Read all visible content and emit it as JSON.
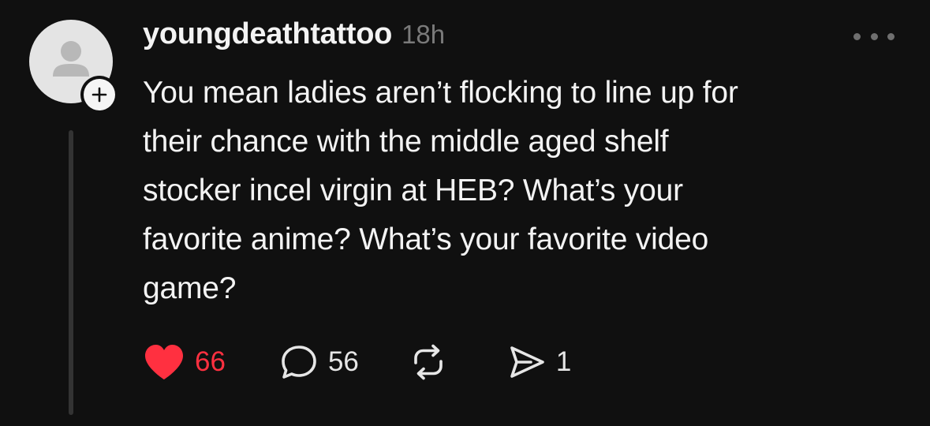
{
  "post": {
    "username": "youngdeathtattoo",
    "timestamp": "18h",
    "text_lines": [
      "You mean ladies aren’t flocking to line up for",
      "their chance with the middle aged shelf",
      "stocker incel virgin at HEB? What’s your",
      "favorite anime? What’s your favorite video",
      "game?"
    ],
    "avatar_icon": "default-user-avatar",
    "follow_icon": "plus-icon"
  },
  "actions": {
    "likes": "66",
    "replies": "56",
    "reposts": "",
    "shares": "1",
    "like_icon": "heart-filled-icon",
    "reply_icon": "speech-bubble-icon",
    "repost_icon": "repost-icon",
    "share_icon": "send-icon"
  },
  "colors": {
    "background": "#101010",
    "like_active": "#ff3040",
    "muted_text": "#7a7a7a",
    "thread_line": "#333333"
  }
}
